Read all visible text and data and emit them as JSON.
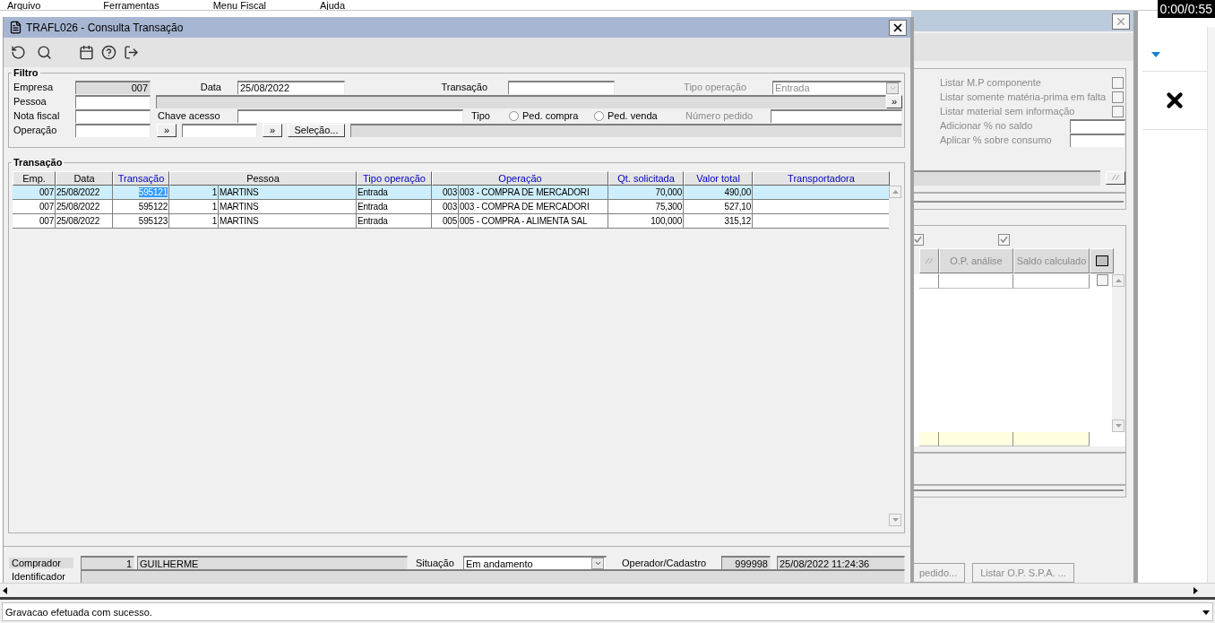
{
  "menu": [
    "Arquivo",
    "Ferramentas",
    "Menu Fiscal",
    "Ajuda"
  ],
  "video_time": "0:00/0:55",
  "window": {
    "title": "TRAFL026 - Consulta Transação"
  },
  "filter": {
    "title": "Filtro",
    "empresa": {
      "label": "Empresa",
      "value": "007"
    },
    "data": {
      "label": "Data",
      "value": "25/08/2022"
    },
    "transacao": {
      "label": "Transação"
    },
    "tipo_operacao": {
      "label": "Tipo operação",
      "value": "Entrada",
      "disabled": true
    },
    "pessoa": {
      "label": "Pessoa"
    },
    "pessoa_more": "»",
    "nota_fiscal": {
      "label": "Nota fiscal"
    },
    "chave_acesso": {
      "label": "Chave acesso"
    },
    "tipo": {
      "label": "Tipo",
      "options": [
        {
          "label": "Ped. compra",
          "selected": false
        },
        {
          "label": "Ped. venda",
          "selected": false
        }
      ]
    },
    "numero_pedido": {
      "label": "Número pedido",
      "disabled": true
    },
    "operacao": {
      "label": "Operação"
    },
    "operacao_more": [
      "»",
      "»"
    ],
    "selection_button": "Seleção..."
  },
  "table": {
    "title": "Transação",
    "columns": [
      {
        "label": "Emp.",
        "highlighted": false
      },
      {
        "label": "Data",
        "highlighted": false
      },
      {
        "label": "Transação",
        "highlighted": true
      },
      {
        "label": "Pessoa",
        "highlighted": false
      },
      {
        "label": "Tipo operação",
        "highlighted": true
      },
      {
        "label": "Operação",
        "highlighted": true
      },
      {
        "label": "Qt. solicitada",
        "highlighted": true
      },
      {
        "label": "Valor total",
        "highlighted": true
      },
      {
        "label": "Transportadora",
        "highlighted": true
      }
    ],
    "rows": [
      {
        "selected": true,
        "transaction_focused": true,
        "cells": [
          "007",
          "25/08/2022",
          "595121",
          [
            "1",
            "MARTINS"
          ],
          "Entrada",
          [
            "003",
            "003 - COMPRA DE MERCADORI"
          ],
          "70,000",
          "490,00"
        ]
      },
      {
        "selected": false,
        "transaction_focused": false,
        "cells": [
          "007",
          "25/08/2022",
          "595122",
          [
            "1",
            "MARTINS"
          ],
          "Entrada",
          [
            "003",
            "003 - COMPRA DE MERCADORI"
          ],
          "75,300",
          "527,10"
        ]
      },
      {
        "selected": false,
        "transaction_focused": false,
        "cells": [
          "007",
          "25/08/2022",
          "595123",
          [
            "1",
            "MARTINS"
          ],
          "Entrada",
          [
            "005",
            "005 - COMPRA - ALIMENTA SAL"
          ],
          "100,000",
          "315,12"
        ]
      }
    ]
  },
  "footer": {
    "comprador": {
      "label": "Comprador",
      "code": "1",
      "name": "GUILHERME"
    },
    "situacao": {
      "label": "Situação",
      "value": "Em andamento"
    },
    "operador": {
      "label": "Operador/Cadastro",
      "code": "999998",
      "date": "25/08/2022 11:24:36"
    },
    "identificador": {
      "label": "Identificador"
    }
  },
  "back_window": {
    "options": [
      {
        "kind": "checkbox",
        "label": "Listar M.P componente",
        "checked": false
      },
      {
        "kind": "checkbox",
        "label": "Listar somente matéria-prima em falta",
        "checked": false
      },
      {
        "kind": "checkbox",
        "label": "Listar material sem informação",
        "checked": false
      },
      {
        "kind": "input",
        "label": "Adicionar % no saldo"
      },
      {
        "kind": "input",
        "label": "Aplicar % sobre consumo"
      }
    ],
    "column_checks": [
      {
        "checked": true
      },
      {
        "checked": true
      }
    ],
    "row_check": {
      "checked": false
    },
    "grid_headers": [
      "O.P. análise",
      "Saldo calculado"
    ],
    "buttons": [
      "pedido...",
      "Listar O.P. S.P.A. ..."
    ]
  },
  "status_bar": "Gravacao efetuada com sucesso."
}
